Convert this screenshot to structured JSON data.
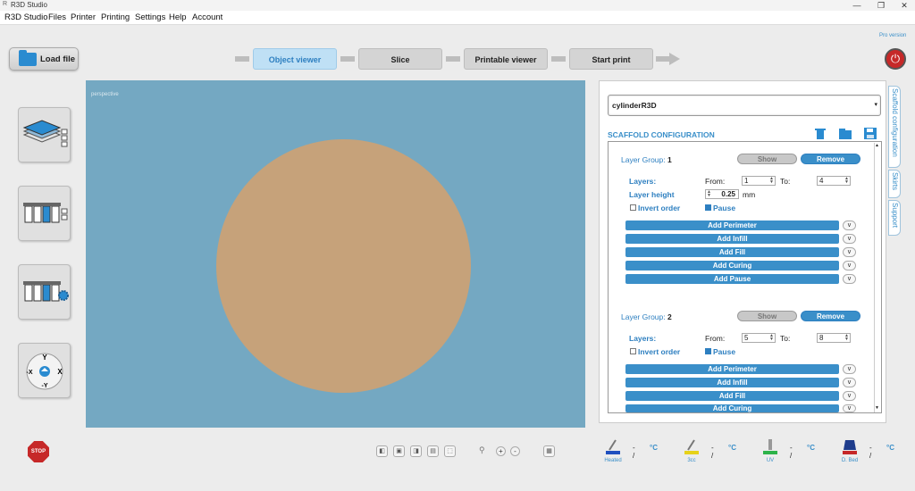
{
  "window": {
    "title": "R3D Studio",
    "logo": "R"
  },
  "menu": [
    "R3D Studio",
    "Files",
    "Printer",
    "Printing",
    "Settings",
    "Help",
    "Account"
  ],
  "pro_label": "Pro version",
  "load_button": "Load file",
  "steps": [
    "Object viewer",
    "Slice",
    "Printable viewer",
    "Start print"
  ],
  "active_step": "Object viewer",
  "viewer": {
    "mode_label": "perspective",
    "object_color": "#c6a27a",
    "background": "#74a8c2"
  },
  "jog": {
    "y_plus": "Y",
    "y_minus": "-Y",
    "x_plus": "X",
    "x_minus": "-X"
  },
  "panel": {
    "model_select": "cylinderR3D",
    "section_title": "SCAFFOLD CONFIGURATION",
    "groups": [
      {
        "label": "Layer Group:",
        "number": "1",
        "show": "Show",
        "remove": "Remove",
        "layers_label": "Layers:",
        "from_label": "From:",
        "from": "1",
        "to_label": "To:",
        "to": "4",
        "height_label": "Layer height",
        "height": "0.25",
        "height_unit": "mm",
        "invert_label": "Invert order",
        "pause_label": "Pause",
        "buttons": [
          "Add Perimeter",
          "Add Infill",
          "Add Fill",
          "Add Curing",
          "Add Pause"
        ]
      },
      {
        "label": "Layer Group:",
        "number": "2",
        "show": "Show",
        "remove": "Remove",
        "layers_label": "Layers:",
        "from_label": "From:",
        "from": "5",
        "to_label": "To:",
        "to": "8",
        "invert_label": "Invert order",
        "pause_label": "Pause",
        "buttons": [
          "Add Perimeter",
          "Add Infill",
          "Add Fill",
          "Add Curing"
        ]
      }
    ],
    "v_label": "v",
    "tabs": [
      "Scaffold configuration",
      "Skirts",
      "Support"
    ]
  },
  "stop_label": "STOP",
  "sensors": [
    {
      "label": "Heated",
      "value": "- /",
      "unit": "°C",
      "color": "#1f4fbf"
    },
    {
      "label": "3cc",
      "value": "- /",
      "unit": "°C",
      "color": "#e6d21a"
    },
    {
      "label": "UV",
      "value": "- /",
      "unit": "°C",
      "color": "#2db34a"
    },
    {
      "label": "D. Bed",
      "value": "- /",
      "unit": "°C",
      "color": "#1e3c8c"
    }
  ]
}
